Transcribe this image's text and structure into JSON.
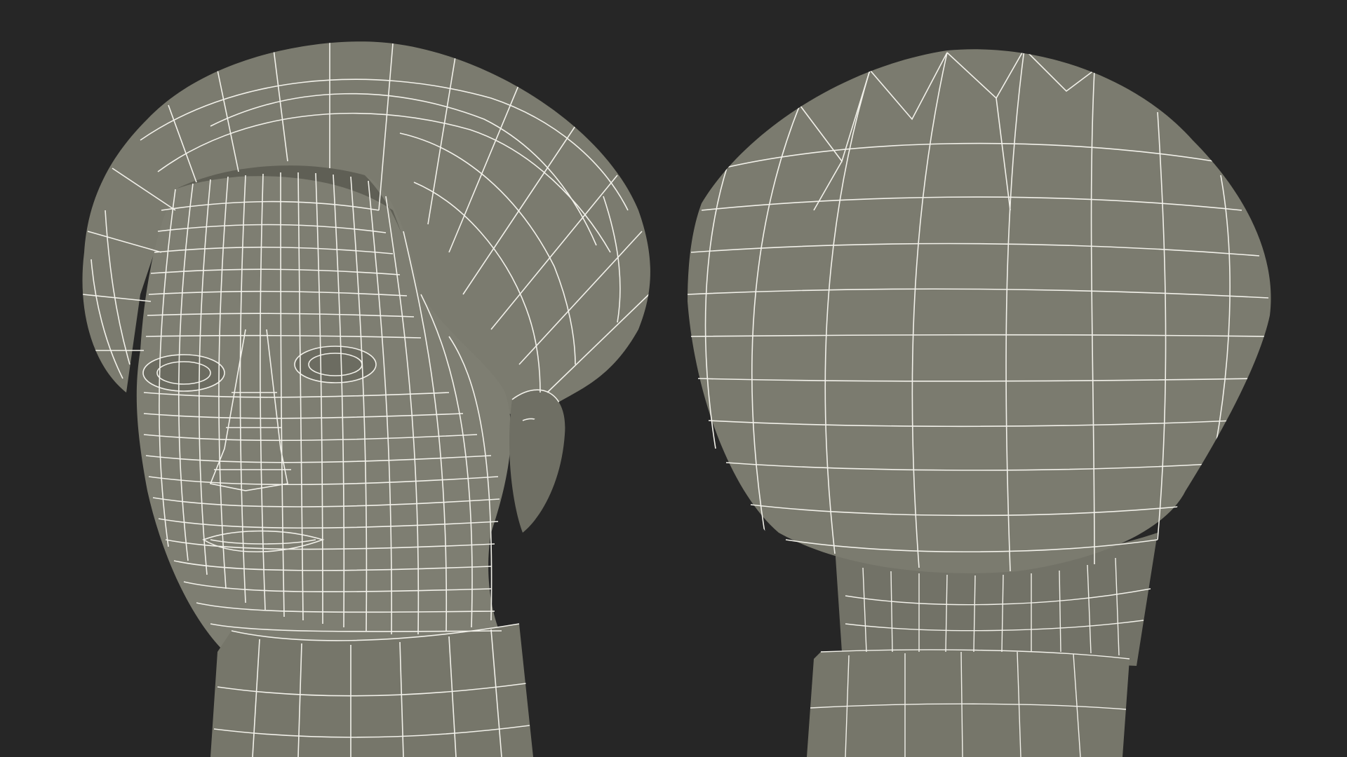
{
  "scene": {
    "background": "#262626",
    "surface": "#7b7b6f",
    "surface_shadow": "#5f5f55",
    "surface_light": "#8a8a7e",
    "wire": "#f2f1ea",
    "subjects": [
      "front-head-wireframe",
      "back-head-wireframe"
    ]
  }
}
